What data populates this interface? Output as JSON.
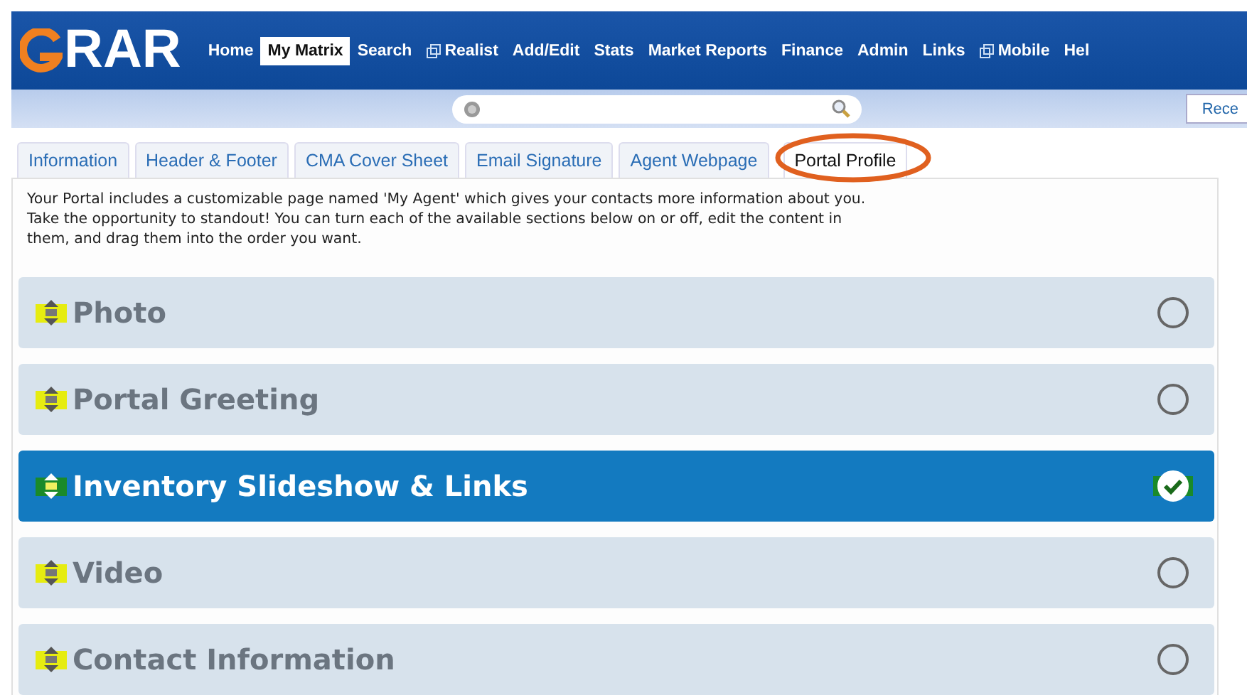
{
  "logo": {
    "text": "RAR"
  },
  "nav": [
    {
      "label": "Home",
      "selected": false,
      "external": false
    },
    {
      "label": "My Matrix",
      "selected": true,
      "external": false
    },
    {
      "label": "Search",
      "selected": false,
      "external": false
    },
    {
      "label": "Realist",
      "selected": false,
      "external": true
    },
    {
      "label": "Add/Edit",
      "selected": false,
      "external": false
    },
    {
      "label": "Stats",
      "selected": false,
      "external": false
    },
    {
      "label": "Market Reports",
      "selected": false,
      "external": false
    },
    {
      "label": "Finance",
      "selected": false,
      "external": false
    },
    {
      "label": "Admin",
      "selected": false,
      "external": false
    },
    {
      "label": "Links",
      "selected": false,
      "external": false
    },
    {
      "label": "Mobile",
      "selected": false,
      "external": true
    },
    {
      "label": "Hel",
      "selected": false,
      "external": false
    }
  ],
  "toolbar": {
    "recent_button": "Rece"
  },
  "tabs": [
    {
      "label": "Information",
      "selected": false
    },
    {
      "label": "Header & Footer",
      "selected": false
    },
    {
      "label": "CMA Cover Sheet",
      "selected": false
    },
    {
      "label": "Email Signature",
      "selected": false
    },
    {
      "label": "Agent Webpage",
      "selected": false
    },
    {
      "label": "Portal Profile",
      "selected": true
    }
  ],
  "description": "Your Portal includes a customizable page named 'My Agent' which gives your contacts more information about you. Take the opportunity to standout! You can turn each of the available sections below on or off, edit the content in them, and drag them into the order you want.",
  "sections": [
    {
      "title": "Photo",
      "on": false
    },
    {
      "title": "Portal Greeting",
      "on": false
    },
    {
      "title": "Inventory Slideshow & Links",
      "on": true
    },
    {
      "title": "Video",
      "on": false
    },
    {
      "title": "Contact Information",
      "on": false
    }
  ]
}
